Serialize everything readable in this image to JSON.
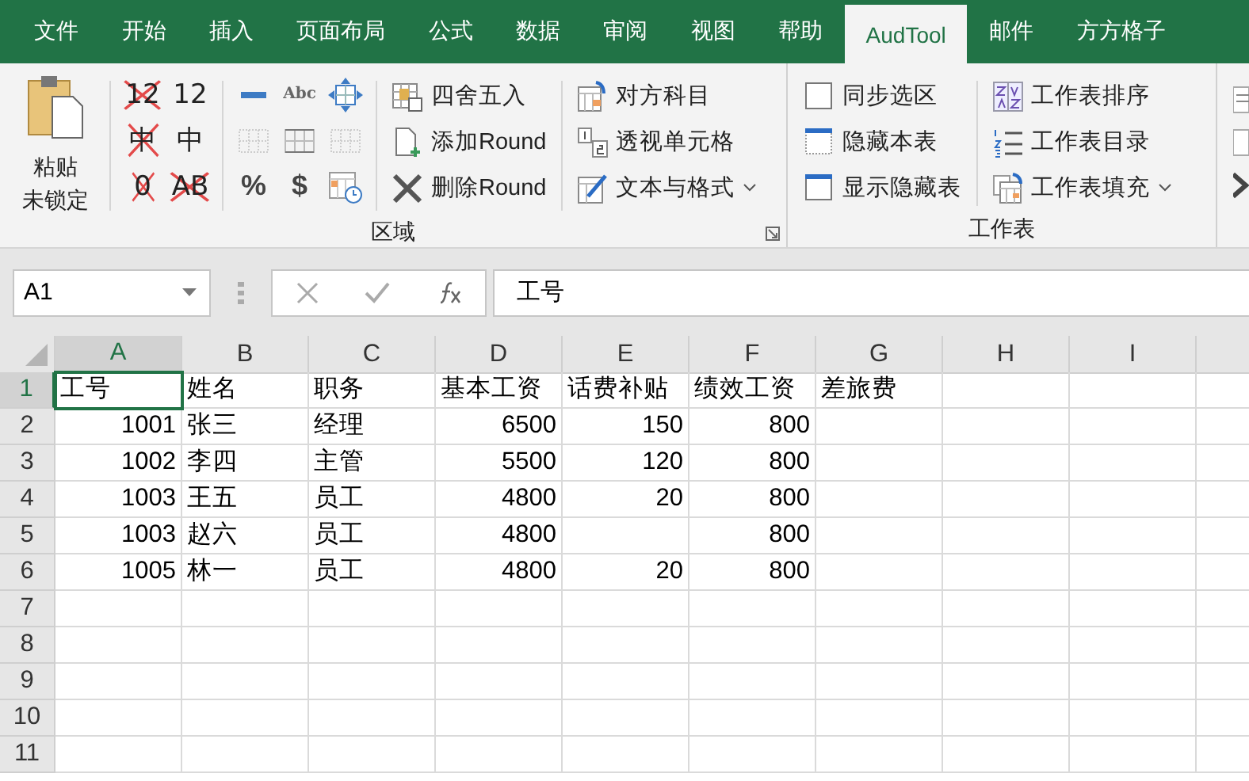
{
  "tabs": [
    {
      "label": "文件",
      "selected": false
    },
    {
      "label": "开始",
      "selected": false
    },
    {
      "label": "插入",
      "selected": false
    },
    {
      "label": "页面布局",
      "selected": false
    },
    {
      "label": "公式",
      "selected": false
    },
    {
      "label": "数据",
      "selected": false
    },
    {
      "label": "审阅",
      "selected": false
    },
    {
      "label": "视图",
      "selected": false
    },
    {
      "label": "帮助",
      "selected": false
    },
    {
      "label": "AudTool",
      "selected": true
    },
    {
      "label": "邮件",
      "selected": false
    },
    {
      "label": "方方格子",
      "selected": false
    }
  ],
  "ribbon": {
    "groups": [
      {
        "title": "区域",
        "paste": [
          "粘贴",
          "未锁定"
        ],
        "format_buttons": [
          {
            "label": "12",
            "struck": true
          },
          {
            "label": "12",
            "struck": false
          },
          {
            "label": "中",
            "struck": true
          },
          {
            "label": "中",
            "struck": false
          },
          {
            "label": "0",
            "struck": true
          },
          {
            "label": "AB",
            "struck": true
          }
        ],
        "symbol_buttons": [
          "Abc",
          "%",
          "$"
        ],
        "lists": [
          [
            {
              "label": "四舍五入",
              "dropdown": false
            },
            {
              "label": "添加Round",
              "dropdown": false
            },
            {
              "label": "删除Round",
              "dropdown": false
            }
          ],
          [
            {
              "label": "对方科目",
              "dropdown": false
            },
            {
              "label": "透视单元格",
              "dropdown": false
            },
            {
              "label": "文本与格式",
              "dropdown": true
            }
          ]
        ]
      },
      {
        "title": "工作表",
        "lists": [
          [
            {
              "label": "同步选区",
              "dropdown": false
            },
            {
              "label": "隐藏本表",
              "dropdown": false
            },
            {
              "label": "显示隐藏表",
              "dropdown": false
            }
          ],
          [
            {
              "label": "工作表排序",
              "dropdown": false
            },
            {
              "label": "工作表目录",
              "dropdown": false
            },
            {
              "label": "工作表填充",
              "dropdown": true
            }
          ]
        ]
      }
    ]
  },
  "formula_bar": {
    "name_box": "A1",
    "formula": "工号"
  },
  "sheet": {
    "columns": [
      {
        "label": "A",
        "selected": true
      },
      {
        "label": "B",
        "selected": false
      },
      {
        "label": "C",
        "selected": false
      },
      {
        "label": "D",
        "selected": false
      },
      {
        "label": "E",
        "selected": false
      },
      {
        "label": "F",
        "selected": false
      },
      {
        "label": "G",
        "selected": false
      },
      {
        "label": "H",
        "selected": false
      },
      {
        "label": "I",
        "selected": false
      }
    ],
    "rows": [
      {
        "label": "1",
        "selected": true,
        "cells": [
          {
            "text": "工号",
            "kind": "text"
          },
          {
            "text": "姓名",
            "kind": "text"
          },
          {
            "text": "职务",
            "kind": "text"
          },
          {
            "text": "基本工资",
            "kind": "text"
          },
          {
            "text": "话费补贴",
            "kind": "text"
          },
          {
            "text": "绩效工资",
            "kind": "text"
          },
          {
            "text": "差旅费",
            "kind": "text"
          }
        ]
      },
      {
        "label": "2",
        "selected": false,
        "cells": [
          {
            "text": "1001",
            "kind": "number"
          },
          {
            "text": "张三",
            "kind": "text"
          },
          {
            "text": "经理",
            "kind": "text"
          },
          {
            "text": "6500",
            "kind": "number"
          },
          {
            "text": "150",
            "kind": "number"
          },
          {
            "text": "800",
            "kind": "number"
          }
        ]
      },
      {
        "label": "3",
        "selected": false,
        "cells": [
          {
            "text": "1002",
            "kind": "number"
          },
          {
            "text": "李四",
            "kind": "text"
          },
          {
            "text": "主管",
            "kind": "text"
          },
          {
            "text": "5500",
            "kind": "number"
          },
          {
            "text": "120",
            "kind": "number"
          },
          {
            "text": "800",
            "kind": "number"
          }
        ]
      },
      {
        "label": "4",
        "selected": false,
        "cells": [
          {
            "text": "1003",
            "kind": "number"
          },
          {
            "text": "王五",
            "kind": "text"
          },
          {
            "text": "员工",
            "kind": "text"
          },
          {
            "text": "4800",
            "kind": "number"
          },
          {
            "text": "20",
            "kind": "number"
          },
          {
            "text": "800",
            "kind": "number"
          }
        ]
      },
      {
        "label": "5",
        "selected": false,
        "cells": [
          {
            "text": "1003",
            "kind": "number"
          },
          {
            "text": "赵六",
            "kind": "text"
          },
          {
            "text": "员工",
            "kind": "text"
          },
          {
            "text": "4800",
            "kind": "number"
          },
          {
            "kind": "empty"
          },
          {
            "text": "800",
            "kind": "number"
          }
        ]
      },
      {
        "label": "6",
        "selected": false,
        "cells": [
          {
            "text": "1005",
            "kind": "number"
          },
          {
            "text": "林一",
            "kind": "text"
          },
          {
            "text": "员工",
            "kind": "text"
          },
          {
            "text": "4800",
            "kind": "number"
          },
          {
            "text": "20",
            "kind": "number"
          },
          {
            "text": "800",
            "kind": "number"
          }
        ]
      },
      {
        "label": "7",
        "selected": false
      },
      {
        "label": "8",
        "selected": false
      },
      {
        "label": "9",
        "selected": false
      },
      {
        "label": "10",
        "selected": false
      },
      {
        "label": "11",
        "selected": false
      }
    ]
  }
}
